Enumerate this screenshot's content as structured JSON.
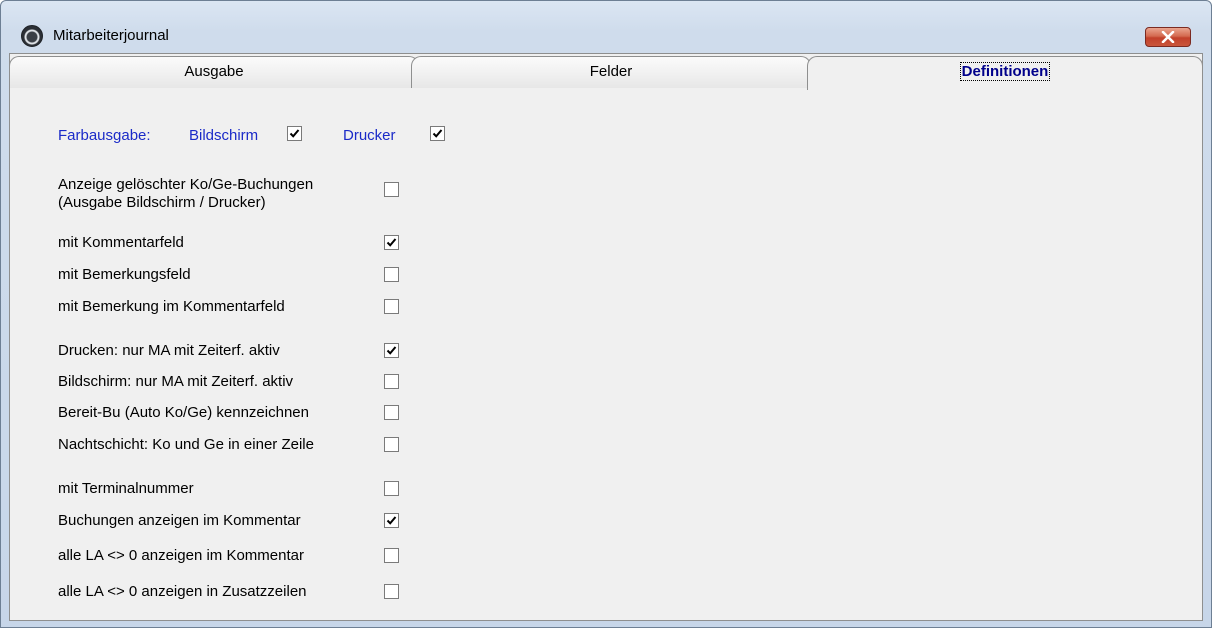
{
  "window": {
    "title": "Mitarbeiterjournal",
    "close_icon": "close-icon"
  },
  "tabs": [
    {
      "label": "Ausgabe",
      "active": false
    },
    {
      "label": "Felder",
      "active": false
    },
    {
      "label": "Definitionen",
      "active": true
    }
  ],
  "farbausgabe": {
    "label": "Farbausgabe:",
    "bildschirm": {
      "label": "Bildschirm",
      "checked": true
    },
    "drucker": {
      "label": "Drucker",
      "checked": true
    }
  },
  "options": [
    {
      "label": "Anzeige gelöschter Ko/Ge-Buchungen",
      "label2": "(Ausgabe Bildschirm / Drucker)",
      "checked": false
    },
    {
      "label": "mit Kommentarfeld",
      "checked": true
    },
    {
      "label": "mit Bemerkungsfeld",
      "checked": false
    },
    {
      "label": "mit Bemerkung im Kommentarfeld",
      "checked": false
    },
    {
      "label": "Drucken: nur MA mit Zeiterf. aktiv",
      "checked": true
    },
    {
      "label": "Bildschirm: nur MA mit Zeiterf. aktiv",
      "checked": false
    },
    {
      "label": "Bereit-Bu (Auto Ko/Ge) kennzeichnen",
      "checked": false
    },
    {
      "label": "Nachtschicht: Ko und Ge in einer Zeile",
      "checked": false
    },
    {
      "label": "mit Terminalnummer",
      "checked": false
    },
    {
      "label": "Buchungen anzeigen im Kommentar",
      "checked": true
    },
    {
      "label": "alle LA <> 0 anzeigen im Kommentar",
      "checked": false
    },
    {
      "label": "alle LA <> 0 anzeigen in Zusatzzeilen",
      "checked": false
    }
  ]
}
